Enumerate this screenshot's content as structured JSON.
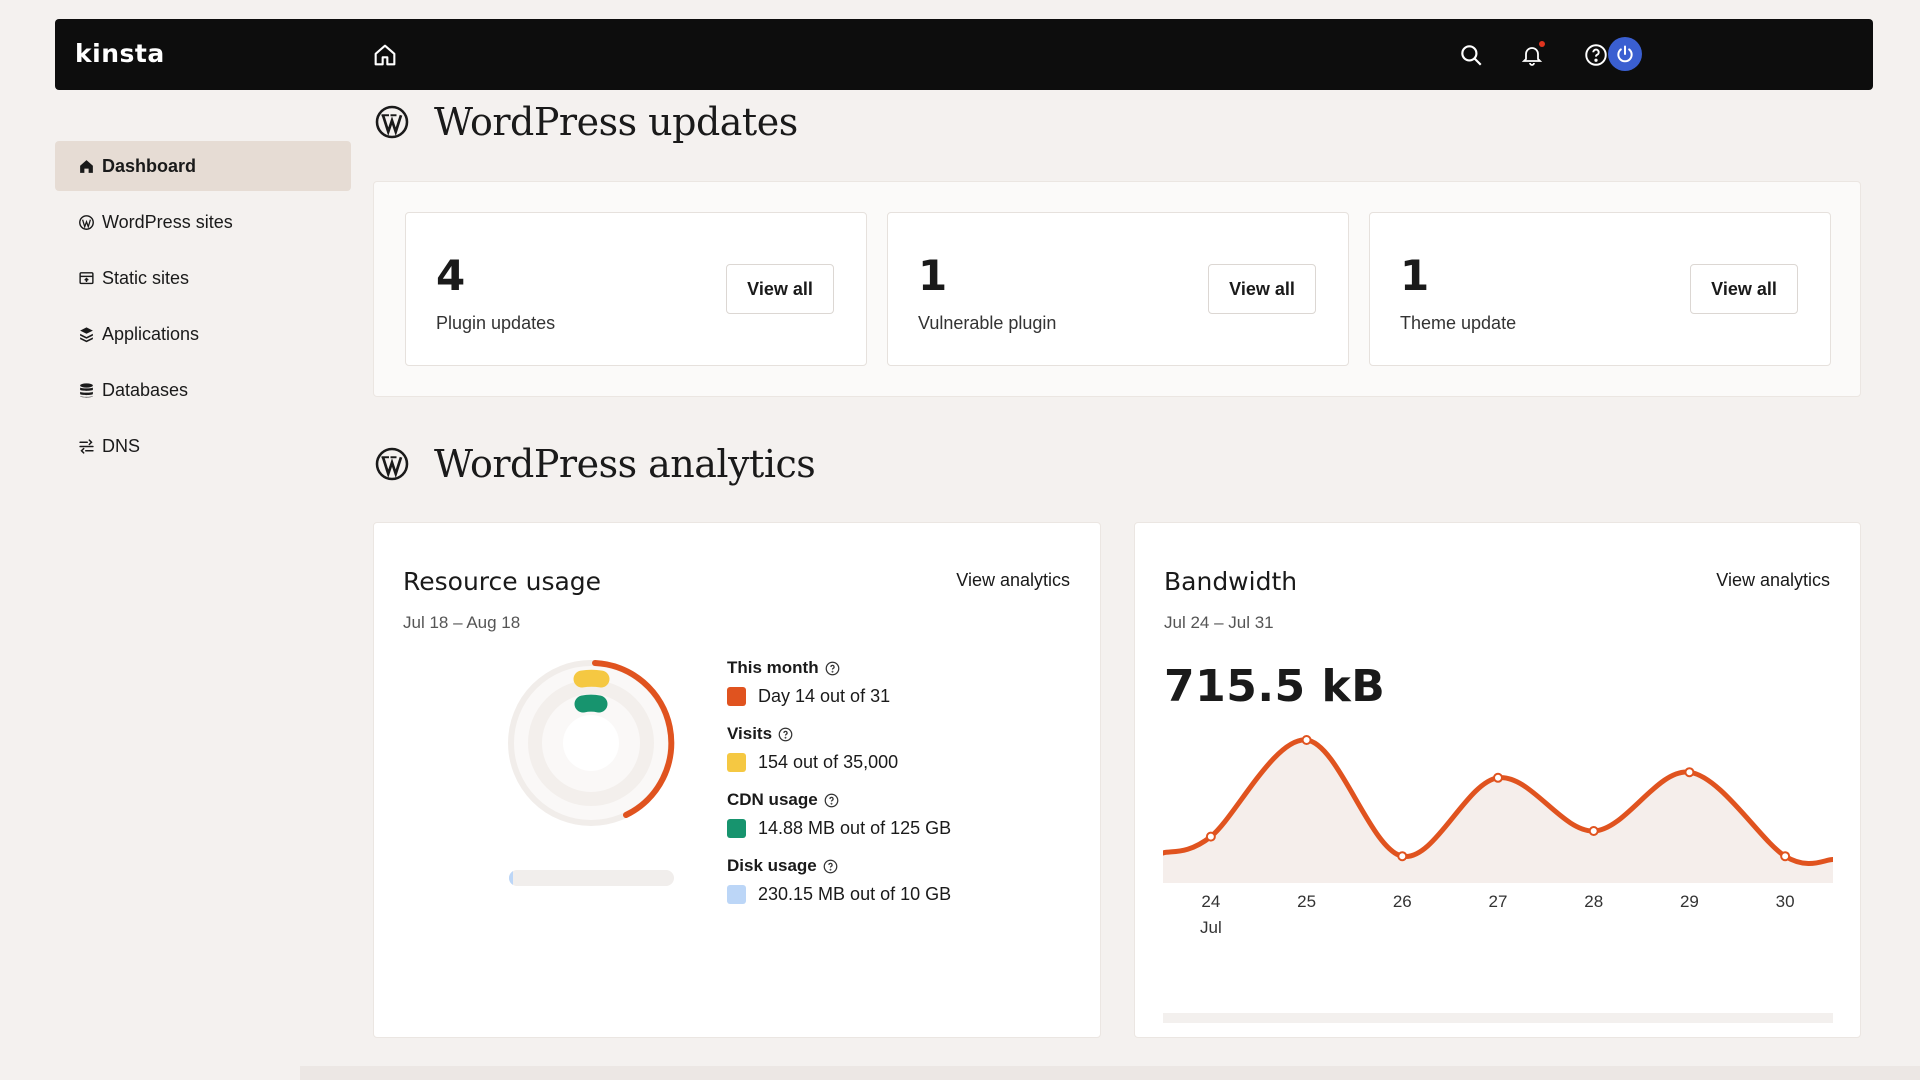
{
  "brand": {
    "logo": "kinsta",
    "accent": "#e0531f"
  },
  "topbar": {
    "icons": [
      "home-icon",
      "search-icon",
      "bell-icon",
      "help-icon",
      "power-icon"
    ]
  },
  "sidebar": {
    "items": [
      {
        "label": "Dashboard",
        "icon": "house-icon",
        "active": true
      },
      {
        "label": "WordPress sites",
        "icon": "wordpress-icon"
      },
      {
        "label": "Static sites",
        "icon": "static-site-icon"
      },
      {
        "label": "Applications",
        "icon": "applications-icon"
      },
      {
        "label": "Databases",
        "icon": "database-icon"
      },
      {
        "label": "DNS",
        "icon": "dns-icon"
      }
    ]
  },
  "updates": {
    "heading": "WordPress updates",
    "cards": [
      {
        "count": "4",
        "label": "Plugin updates",
        "button": "View all"
      },
      {
        "count": "1",
        "label": "Vulnerable plugin",
        "button": "View all"
      },
      {
        "count": "1",
        "label": "Theme update",
        "button": "View all"
      }
    ]
  },
  "analytics": {
    "heading": "WordPress analytics",
    "resource": {
      "title": "Resource usage",
      "link": "View analytics",
      "date": "Jul 18 – Aug 18",
      "this_month_label": "This month",
      "this_month_value": "Day 14 out of 31",
      "visits_label": "Visits",
      "visits_value": "154 out of 35,000",
      "cdn_label": "CDN usage",
      "cdn_value": "14.88 MB out of 125 GB",
      "disk_label": "Disk usage",
      "disk_value": "230.15 MB out of 10 GB",
      "colors": {
        "month": "#e0531f",
        "visits": "#f5c842",
        "cdn": "#17946e",
        "disk": "#bcd6f7"
      }
    },
    "bandwidth": {
      "title": "Bandwidth",
      "link": "View analytics",
      "date": "Jul 24 – Jul 31",
      "value": "715.5 kB",
      "month_label": "Jul"
    }
  },
  "chart_data": {
    "type": "line",
    "x": [
      "24",
      "25",
      "26",
      "27",
      "28",
      "29",
      "30"
    ],
    "series": [
      {
        "values": [
          0.26,
          0.95,
          0.12,
          0.68,
          0.3,
          0.72,
          0.12
        ]
      }
    ],
    "x_extent": [
      23.5,
      30.5
    ],
    "ylim": [
      0,
      1
    ],
    "grid": false
  }
}
